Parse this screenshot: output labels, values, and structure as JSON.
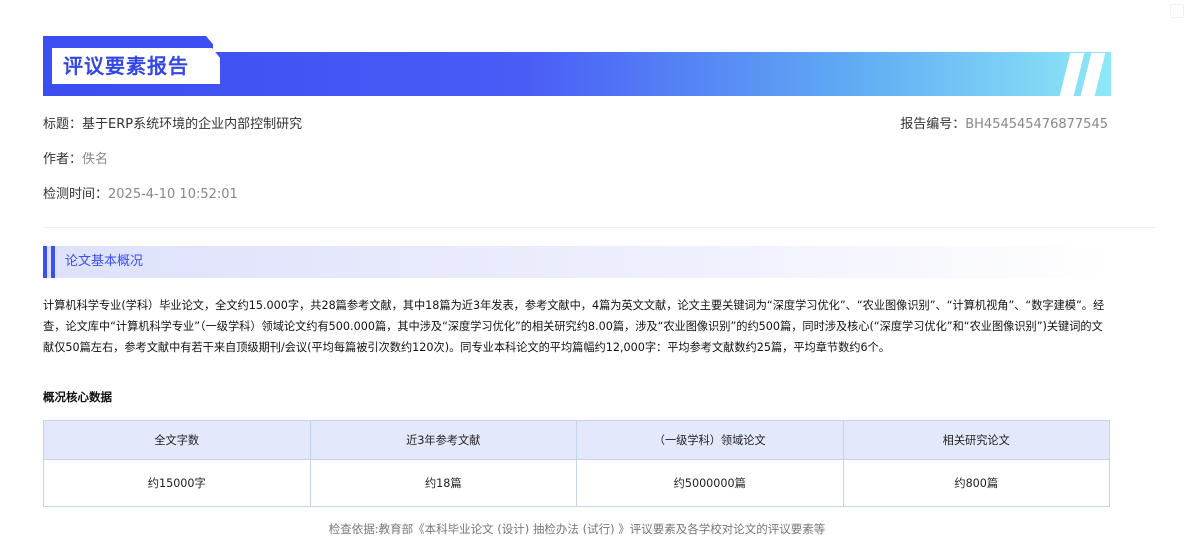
{
  "header": {
    "title": "评议要素报告"
  },
  "meta": {
    "title_label": "标题：",
    "title_value": "基于ERP系统环境的企业内部控制研究",
    "author_label": "作者：",
    "author_value": "佚名",
    "time_label": "检测时间：",
    "time_value": "2025-4-10 10:52:01",
    "report_no_label": "报告编号：",
    "report_no_value": "BH454545476877545"
  },
  "section": {
    "title": "论文基本概况",
    "paragraph": "计算机科学专业(学科）毕业论文，全文约15.000字，共28篇参考文献，其中18篇为近3年发表，参考文献中，4篇为英文文献，论文主要关键词为“深度学习优化”、“农业图像识别”、“计算机视角”、“数字建模”。经查，论文库中“计算机科学专业”（一级学科）领域论文约有500.000篇，其中涉及“深度学习优化”的相关研究约8.00篇，涉及“农业图像识别”的约500篇，同时涉及核心(“深度学习优化”和“农业图像识别”)关键词的文献仅50篇左右，参考文献中有若干来自顶级期刊/会议(平均每篇被引次数约120次)。同专业本科论文的平均篇幅约12,000字：平均参考文献数约25篇，平均章节数约6个。",
    "core_title": "概况核心数据"
  },
  "table": {
    "headers": [
      "全文字数",
      "近3年参考文献",
      "（一级学科）领域论文",
      "相关研究论文"
    ],
    "values": [
      "约15000字",
      "约18篇",
      "约5000000篇",
      "约800篇"
    ]
  },
  "footer": {
    "text": "检查依据:教育部《本科毕业论文 (设计) 抽检办法 (试行) 》评议要素及各学校对论文的评议要素等"
  },
  "colors": {
    "accent": "#3b4ff2",
    "gradient_end": "#8ee8f7",
    "table_header_bg": "#e3e8fb"
  }
}
